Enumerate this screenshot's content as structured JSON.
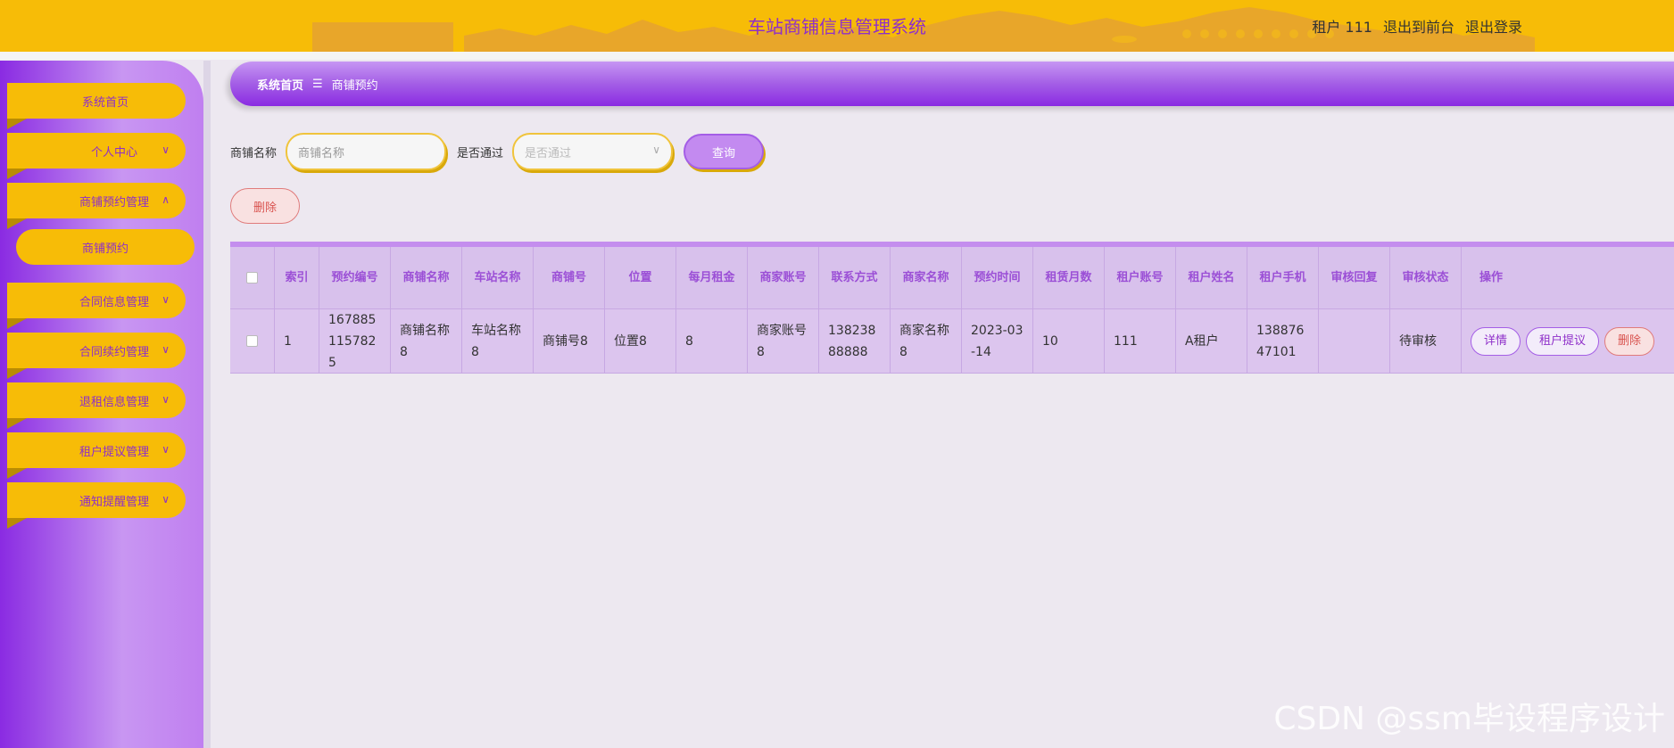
{
  "header": {
    "title": "车站商铺信息管理系统",
    "user_label": "租户 111",
    "front_link": "退出到前台",
    "logout_link": "退出登录"
  },
  "sidebar": {
    "items": [
      {
        "label": "系统首页"
      },
      {
        "label": "个人中心"
      },
      {
        "label": "商铺预约管理"
      },
      {
        "label": "商铺预约"
      },
      {
        "label": "合同信息管理"
      },
      {
        "label": "合同续约管理"
      },
      {
        "label": "退租信息管理"
      },
      {
        "label": "租户提议管理"
      },
      {
        "label": "通知提醒管理"
      }
    ]
  },
  "breadcrumb": {
    "home": "系统首页",
    "separator": "☰",
    "current": "商铺预约"
  },
  "search": {
    "name_label": "商铺名称",
    "name_placeholder": "商铺名称",
    "pass_label": "是否通过",
    "pass_placeholder": "是否通过",
    "query_button": "查询"
  },
  "toolbar": {
    "delete_button": "删除"
  },
  "table": {
    "headers": [
      "索引",
      "预约编号",
      "商铺名称",
      "车站名称",
      "商铺号",
      "位置",
      "每月租金",
      "商家账号",
      "联系方式",
      "商家名称",
      "预约时间",
      "租赁月数",
      "租户账号",
      "租户姓名",
      "租户手机",
      "审核回复",
      "审核状态",
      "操作"
    ],
    "rows": [
      {
        "index": "1",
        "booking_no": "1678851157825",
        "shop_name": "商铺名称8",
        "station_name": "车站名称8",
        "shop_no": "商铺号8",
        "location": "位置8",
        "monthly_rent": "8",
        "merchant_account": "商家账号8",
        "contact": "13823888888",
        "merchant_name": "商家名称8",
        "booking_time": "2023-03-14",
        "lease_months": "10",
        "tenant_account": "111",
        "tenant_name": "A租户",
        "tenant_phone": "13887647101",
        "review_reply": "",
        "review_status": "待审核",
        "ops": {
          "detail": "详情",
          "suggest": "租户提议",
          "delete": "删除"
        }
      }
    ]
  },
  "watermark": "CSDN @ssm毕设程序设计",
  "colors": {
    "header_bg": "#f7bc07",
    "accent_purple": "#8a2be2",
    "title_purple": "#8f2fc9"
  }
}
